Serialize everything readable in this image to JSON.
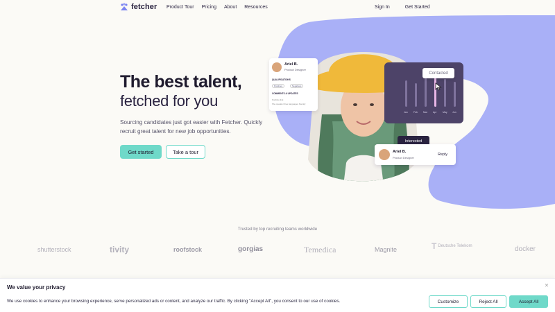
{
  "nav": {
    "brand": "fetcher",
    "links": [
      "Product Tour",
      "Pricing",
      "About",
      "Resources"
    ],
    "sign_in": "Sign In",
    "get_started": "Get Started"
  },
  "hero": {
    "title_line1": "The best talent,",
    "title_line2": "fetched for you",
    "subtitle": "Sourcing candidates just got easier with Fetcher. Quickly recruit great talent for new job opportunities.",
    "primary_button": "Get started",
    "secondary_button": "Take a tour"
  },
  "illustration": {
    "profile_card": {
      "name": "Ariel B.",
      "role": "Product Designer",
      "qualifications_label": "QUALIFICATIONS",
      "chip_positives": "Positives",
      "chip_negatives": "Negatives",
      "comments_label": "COMMENTS & UPDATES",
      "note_line1": "Portfolio link",
      "note_line2": "She speaks three languages fluently"
    },
    "chart": {
      "months": [
        "Jan",
        "Feb",
        "Mar",
        "Apr",
        "May",
        "Jun"
      ],
      "contacted_label": "Contacted"
    },
    "reply_card": {
      "status": "Interested",
      "name": "Ariel B.",
      "role": "Product Designer",
      "reply": "Reply"
    },
    "colors": {
      "blob": "#a9b0f7",
      "chart_bg": "#4d4368",
      "accent": "#6fd9c9"
    }
  },
  "trusted": {
    "label": "Trusted by top recruiting teams worldwide",
    "logos": [
      "shutterstock",
      "tivity",
      "roofstock",
      "gorgias",
      "Temedica",
      "Magnite",
      "Deutsche Telekom",
      "docker"
    ]
  },
  "cookie": {
    "title": "We value your privacy",
    "text": "We use cookies to enhance your browsing experience, serve personalized ads or content, and analyze our traffic. By clicking \"Accept All\", you consent to our use of cookies.",
    "customize": "Customize",
    "reject": "Reject All",
    "accept": "Accept All",
    "close_icon": "close-icon"
  }
}
